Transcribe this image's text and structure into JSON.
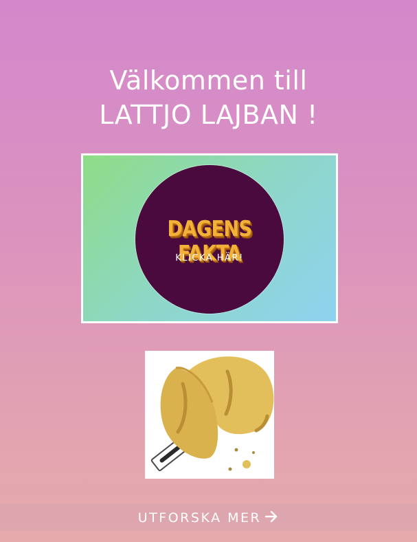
{
  "welcome": {
    "line1": "Välkommen till",
    "line2": "LATTJO LAJBAN !"
  },
  "banner": {
    "title": "DAGENS FAKTA",
    "subtitle": "KLICKA HÄR!"
  },
  "cookie": {
    "icon": "fortune-cookie-icon"
  },
  "footer": {
    "explore_label": "UTFORSKA MER",
    "arrow_icon": "arrow-right-icon"
  },
  "colors": {
    "background_top": "#d388cc",
    "background_bottom": "#e6aaac",
    "banner_circle": "#4a0a3d",
    "banner_title": "#f2b23a",
    "cookie": "#e2bf5a"
  }
}
